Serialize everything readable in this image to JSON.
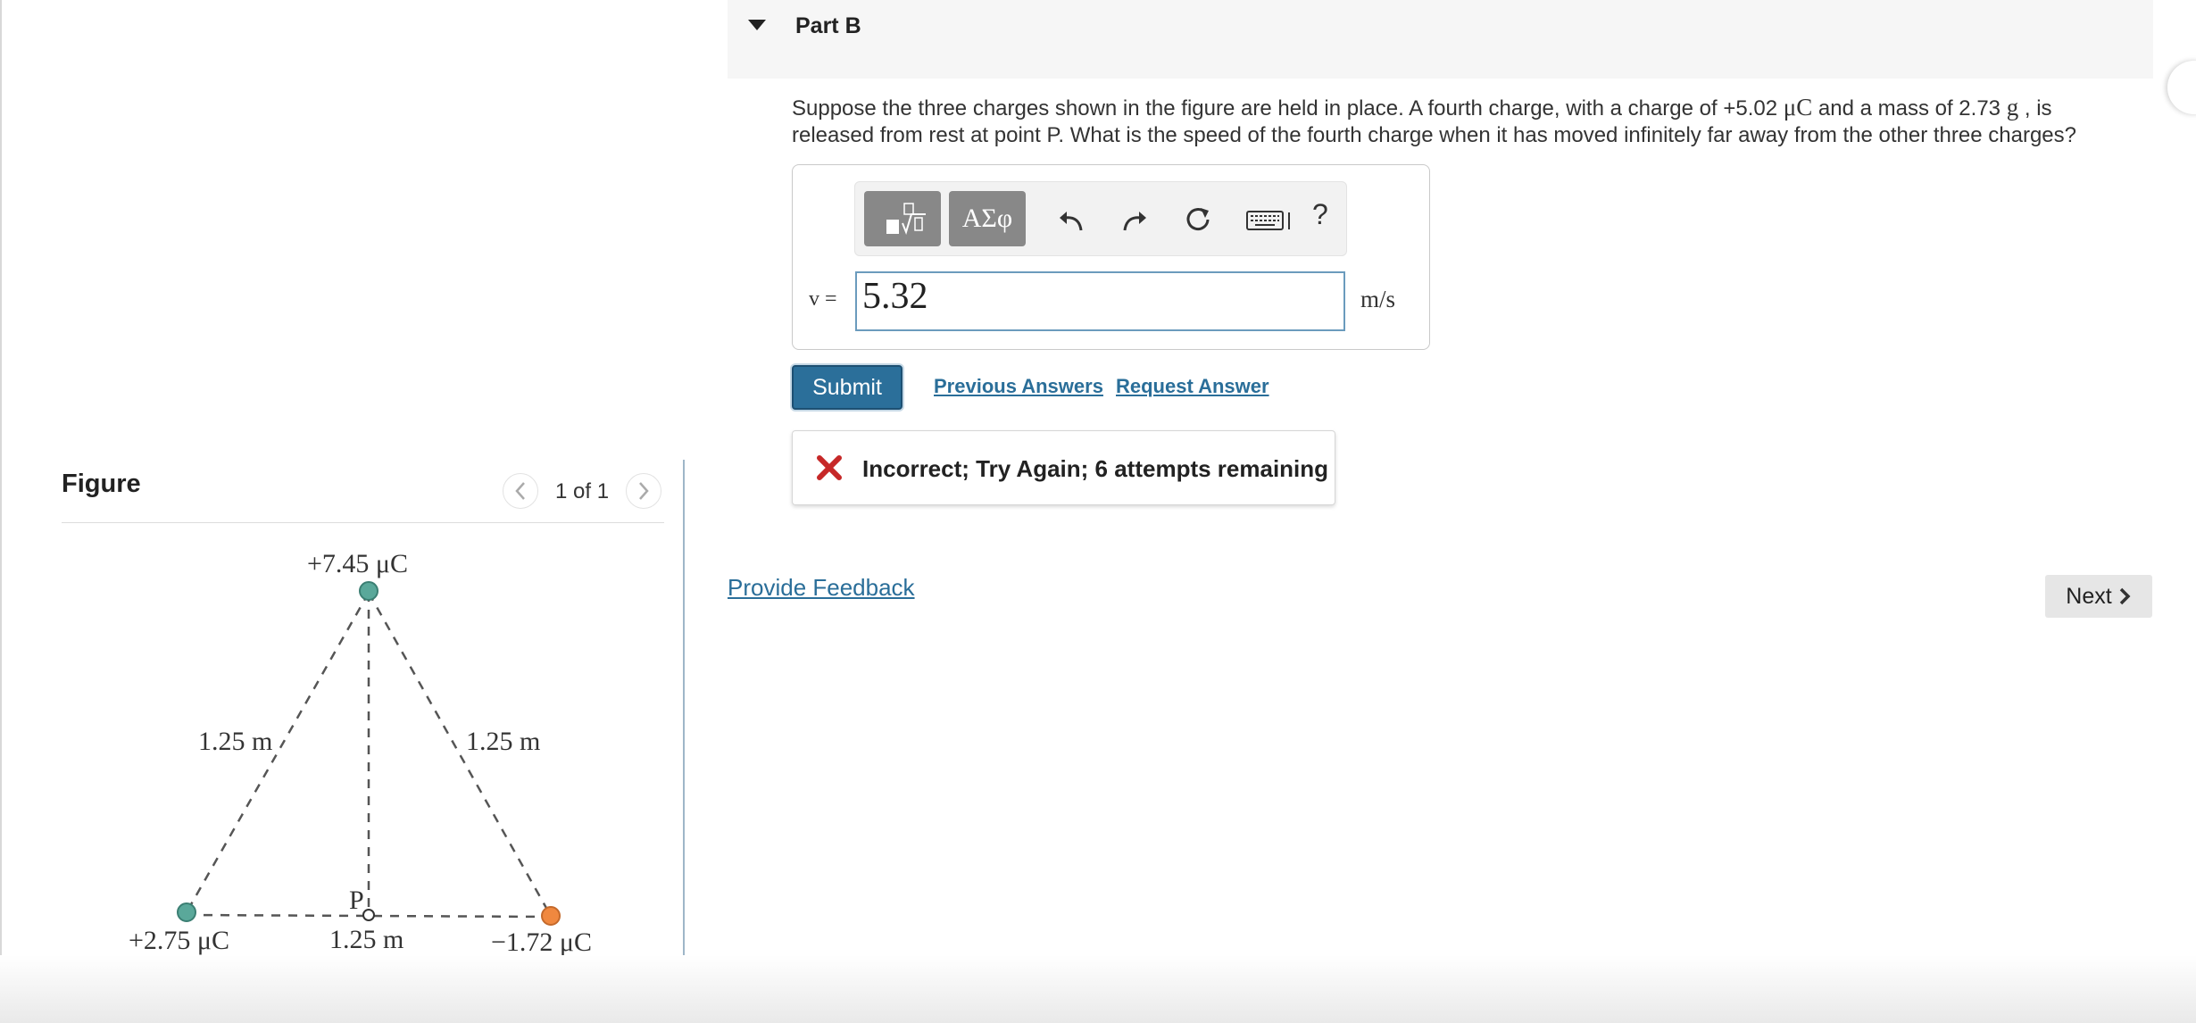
{
  "figure_panel": {
    "title": "Figure",
    "counter": "1 of 1",
    "diagram": {
      "top_charge": "+7.45 μC",
      "left_charge": "+2.75 μC",
      "right_charge": "−1.72 μC",
      "left_side_length": "1.25 m",
      "right_side_length": "1.25 m",
      "base_length": "1.25 m",
      "point_label": "P",
      "colors": {
        "top_charge": "#5aa89a",
        "left_charge": "#5aa89a",
        "right_charge": "#f0883f"
      }
    }
  },
  "part": {
    "title": "Part B",
    "question": {
      "text_1": "Suppose the three charges shown in the figure are held in place. A fourth charge, with a charge of +5.02 ",
      "unit_charge": "μC",
      "text_2": " and a mass of 2.73 ",
      "unit_mass": "g",
      "text_3": " , is released from rest at point P. What is the speed of the fourth charge when it has moved infinitely far away from the other three charges?"
    },
    "toolbar": {
      "templates_icon": "templates-icon",
      "symbols_label": "ΑΣφ",
      "undo_icon": "undo-icon",
      "redo_icon": "redo-icon",
      "reset_icon": "reset-icon",
      "keyboard_icon": "keyboard-icon",
      "help_label": "?"
    },
    "answer": {
      "variable_label": "v =",
      "value": "5.32",
      "unit": "m/s"
    },
    "actions": {
      "submit": "Submit",
      "previous_answers": "Previous Answers",
      "request_answer": "Request Answer"
    },
    "feedback": {
      "icon": "x-mark-icon",
      "message": "Incorrect; Try Again; 6 attempts remaining",
      "icon_color": "#c62828"
    },
    "provide_feedback": "Provide Feedback",
    "next": "Next"
  }
}
